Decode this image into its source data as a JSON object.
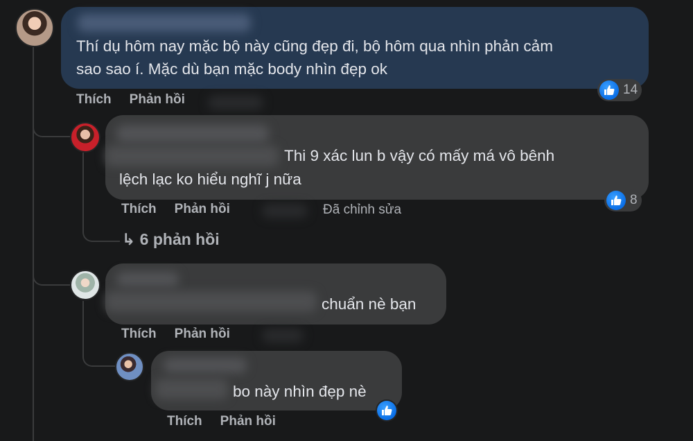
{
  "comments": [
    {
      "text_lines": [
        "Thí dụ hôm nay mặc bộ này cũng đẹp đi, bộ hôm qua nhìn phản cảm",
        "sao sao í. Mặc dù bạn mặc body nhìn đẹp ok"
      ],
      "reaction": {
        "icon": "like-icon",
        "count": "14"
      },
      "actions": {
        "like": "Thích",
        "reply": "Phản hồi"
      }
    },
    {
      "text_lines": [
        "Thi 9 xác lun b vậy có mấy má vô bênh",
        "lệch lạc ko hiểu nghĩ j nữa"
      ],
      "reaction": {
        "icon": "like-icon",
        "count": "8"
      },
      "actions": {
        "like": "Thích",
        "reply": "Phản hồi"
      },
      "edited": "Đã chỉnh sửa",
      "view_replies": "↳ 6 phản hồi"
    },
    {
      "text_lines": [
        "chuẩn nè bạn"
      ],
      "actions": {
        "like": "Thích",
        "reply": "Phản hồi"
      }
    },
    {
      "text_lines": [
        "bo này nhìn đẹp nè"
      ],
      "reaction": {
        "icon": "like-icon"
      },
      "actions": {
        "like": "Thích",
        "reply": "Phản hồi"
      }
    }
  ],
  "colors": {
    "background": "#18191a",
    "bubble": "#3a3b3c",
    "highlighted_bubble": "#263951",
    "secondary_text": "#b0b3b8",
    "like_blue": "#0a6ee6"
  }
}
